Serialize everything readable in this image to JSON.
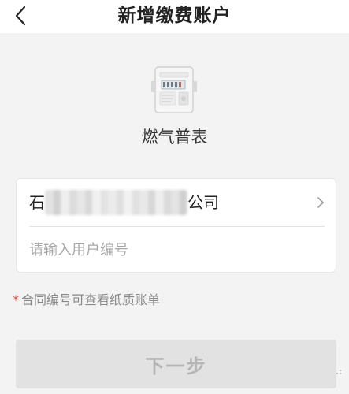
{
  "header": {
    "title": "新增缴费账户",
    "back_icon": "chevron-left-icon"
  },
  "meter": {
    "label": "燃气普表",
    "icon": "gas-meter-icon"
  },
  "form": {
    "company_prefix": "石",
    "company_suffix": "公司",
    "company_arrow_icon": "chevron-right-icon",
    "user_number_placeholder": "请输入用户编号",
    "user_number_value": ""
  },
  "hint": {
    "star": "*",
    "text": "合同编号可查看纸质账单"
  },
  "actions": {
    "next_label": "下一步"
  },
  "colors": {
    "accent_red": "#e04a3a",
    "disabled_button": "#e2e2e2",
    "page_bg": "#f3f3f3"
  }
}
